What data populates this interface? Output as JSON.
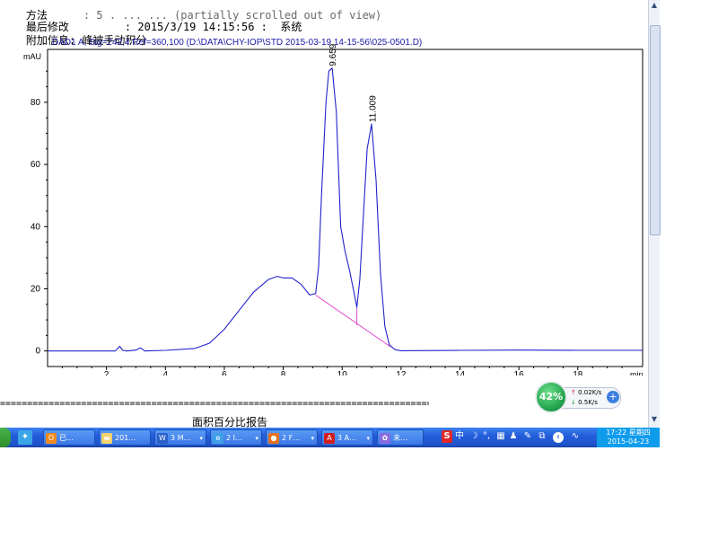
{
  "document": {
    "meta": [
      {
        "label": "方法",
        "value": ": 5 . ... ... (partially scrolled out of view)"
      },
      {
        "label": "最后修改",
        "value": ": 2015/3/19 14:15:56 :  系统"
      },
      {
        "label": "附加信息",
        "value": ": 峰被手动积分"
      }
    ],
    "separator": "================================================================================================================",
    "report_title": "面积百分比报告"
  },
  "chart_data": {
    "type": "line",
    "title": "DAD1 A, Sig=242,4 Ref=360,100 (D:\\DATA\\CHY-IOP\\STD 2015-03-19 14-15-56\\025-0501.D)",
    "ylabel": "mAU",
    "xlabel": "min",
    "xlim": [
      0,
      20.2
    ],
    "ylim": [
      -5,
      97
    ],
    "xticks": [
      2,
      4,
      6,
      8,
      10,
      12,
      14,
      16,
      18
    ],
    "yticks": [
      0,
      20,
      40,
      60,
      80
    ],
    "grid": false,
    "series": [
      {
        "color": "#2222cc",
        "x": [
          0,
          2.3,
          2.45,
          2.55,
          2.7,
          3.0,
          3.15,
          3.3,
          4.0,
          5.0,
          5.5,
          6.0,
          6.5,
          7.0,
          7.5,
          7.8,
          8.0,
          8.3,
          8.6,
          8.9,
          9.1,
          9.2,
          9.3,
          9.45,
          9.55,
          9.66,
          9.8,
          9.95,
          10.1,
          10.25,
          10.4,
          10.5,
          10.6,
          10.7,
          10.85,
          11.0,
          11.15,
          11.3,
          11.45,
          11.6,
          11.8,
          12.0,
          14.0,
          16.0,
          18.0,
          20.2
        ],
        "y": [
          0,
          0,
          1.5,
          0.2,
          0,
          0.3,
          1.0,
          0,
          0.2,
          0.8,
          2.5,
          7,
          13,
          19,
          23,
          24,
          23.5,
          23.5,
          21.5,
          18,
          18.5,
          27,
          50,
          80,
          90,
          91,
          77,
          40,
          32,
          26,
          19,
          14,
          23,
          40,
          65,
          73,
          55,
          25,
          8,
          2,
          0.4,
          0.1,
          0.2,
          0.3,
          0.2,
          0.2
        ]
      }
    ],
    "baseline": {
      "color": "#e050d0",
      "x": [
        9.1,
        11.65
      ],
      "y": [
        18,
        1.3
      ]
    },
    "peaks": [
      {
        "label": "9.659",
        "x": 9.66,
        "y": 91
      },
      {
        "label": "11.009",
        "x": 11.01,
        "y": 73
      }
    ]
  },
  "taskbar": {
    "start_color": "#3aa63a",
    "quick_launch": [
      {
        "icon": "qq-icon"
      }
    ],
    "tasks": [
      {
        "label": "已…",
        "icon": "office-icon",
        "icon_color": "#f08a1c",
        "icon_text": "O"
      },
      {
        "label": "201…",
        "icon": "folder-icon",
        "icon_color": "#f3d36b",
        "icon_text": "▬"
      },
      {
        "label": "3 M…",
        "icon": "word-icon",
        "icon_color": "#2a5fc9",
        "icon_text": "W"
      },
      {
        "label": "2 I…",
        "icon": "ie-icon",
        "icon_color": "#3fa0e8",
        "icon_text": "e"
      },
      {
        "label": "2 F…",
        "icon": "firefox-icon",
        "icon_color": "#e5701c",
        "icon_text": "●"
      },
      {
        "label": "3 A…",
        "icon": "acrobat-icon",
        "icon_color": "#d21e1e",
        "icon_text": "A"
      },
      {
        "label": "未…",
        "icon": "app-icon",
        "icon_color": "#8a6be0",
        "icon_text": "✿"
      }
    ],
    "tray": {
      "items": [
        "sogou-s-icon",
        "zh-icon",
        "moon-icon",
        "punct-icon",
        "keyboard-icon",
        "user-icon",
        "wrench-icon",
        "edit-icon",
        "back-icon",
        "wave-icon"
      ],
      "zh_label": "中",
      "clock_time": "17:22 星期四",
      "clock_date": "2015-04-23"
    }
  },
  "net_widget": {
    "percent": "42%",
    "up": "0.02K/s",
    "down": "0.5K/s",
    "up_arrow": "↑",
    "down_arrow": "↓",
    "plus": "+"
  }
}
